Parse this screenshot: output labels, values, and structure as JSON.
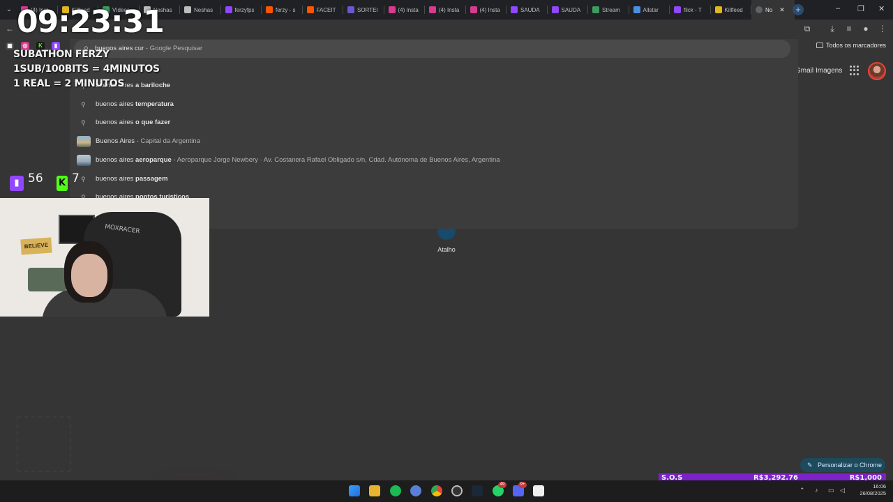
{
  "tabs": [
    {
      "label": "(4) Inst",
      "icon": "instagram-icon",
      "color": "#d63b8f"
    },
    {
      "label": "Killfeed",
      "icon": "killfeed-icon",
      "color": "#e1b521"
    },
    {
      "label": "Vídeos",
      "icon": "drive-icon",
      "color": "#3c9b5e"
    },
    {
      "label": "Neshas",
      "icon": "neshas-icon",
      "color": "#bdbdbd"
    },
    {
      "label": "Neshas",
      "icon": "neshas-icon",
      "color": "#bdbdbd"
    },
    {
      "label": "ferzyfps",
      "icon": "twitch-icon",
      "color": "#9146ff"
    },
    {
      "label": "ferzy - s",
      "icon": "faceit-icon",
      "color": "#ff5500"
    },
    {
      "label": "FACEIT",
      "icon": "faceit-icon",
      "color": "#ff5500"
    },
    {
      "label": "SORTEI",
      "icon": "sorteio-icon",
      "color": "#6e56cf"
    },
    {
      "label": "(4) Insta",
      "icon": "instagram-icon",
      "color": "#d63b8f"
    },
    {
      "label": "(4) Insta",
      "icon": "instagram-icon",
      "color": "#d63b8f"
    },
    {
      "label": "(4) Insta",
      "icon": "instagram-icon",
      "color": "#d63b8f"
    },
    {
      "label": "SAUDA",
      "icon": "twitch-icon",
      "color": "#9146ff"
    },
    {
      "label": "SAUDA",
      "icon": "twitch-icon",
      "color": "#9146ff"
    },
    {
      "label": "Stream",
      "icon": "streamelements-icon",
      "color": "#3c9b5e"
    },
    {
      "label": "Allstar",
      "icon": "allstar-icon",
      "color": "#4a90e2"
    },
    {
      "label": "flick - T",
      "icon": "twitch-icon",
      "color": "#9146ff"
    },
    {
      "label": "Killfeed",
      "icon": "killfeed-icon",
      "color": "#e1b521"
    }
  ],
  "active_tab": {
    "label": "No",
    "close": "✕"
  },
  "new_tab": "+",
  "window_controls": {
    "minimize": "–",
    "restore": "❐",
    "close": "✕"
  },
  "bookmarks": {
    "all": "Todos os marcadores"
  },
  "omnibox": {
    "typed": "buenos aires cur",
    "suffix": " - Google Pesquisar",
    "suggestions": [
      {
        "prefix": "buenos aires ",
        "bold": "a bariloche",
        "detail": "",
        "kind": "search"
      },
      {
        "prefix": "buenos aires ",
        "bold": "temperatura",
        "detail": "",
        "kind": "search"
      },
      {
        "prefix": "buenos aires ",
        "bold": "o que fazer",
        "detail": "",
        "kind": "search"
      },
      {
        "prefix": "Buenos Aires",
        "bold": "",
        "detail": " - Capital da Argentina",
        "kind": "entity"
      },
      {
        "prefix": "buenos aires ",
        "bold": "aeroparque",
        "detail": " - Aeroparque Jorge Newbery · Av. Costanera Rafael Obligado s/n, Cdad. Autónoma de Buenos Aires, Argentina",
        "kind": "place"
      },
      {
        "prefix": "buenos aires ",
        "bold": "passagem",
        "detail": "",
        "kind": "search"
      },
      {
        "prefix": "buenos aires ",
        "bold": "pontos turisticos",
        "detail": "",
        "kind": "search"
      }
    ]
  },
  "ntp": {
    "gmail": "Gmail",
    "images": "Imagens",
    "shortcut_label": "Atalho",
    "customize": "Personalizar o Chrome"
  },
  "overlay": {
    "timer": "09:23:31",
    "line1": "SUBATHON FERZY",
    "line2": "1SUB/100BITS = 4MINUTOS",
    "line3": "1 REAL = 2 MINUTOS",
    "twitch_count": "56",
    "kick_count": "7"
  },
  "webcam": {
    "chair_brand": "MOXRACER",
    "sign": "BELIEVE"
  },
  "goal": {
    "name": "S.O.S",
    "current": "R$3,292.76",
    "target": "R$1,000"
  },
  "taskbar": {
    "items": [
      "windows-start-icon",
      "file-explorer-icon",
      "spotify-icon",
      "app-icon",
      "chrome-icon",
      "obs-icon",
      "steam-icon",
      "whatsapp-icon",
      "discord-icon",
      "capcut-icon"
    ],
    "whatsapp_badge": "49",
    "discord_badge": "9+",
    "time": "16:06",
    "date": "26/08/2025"
  }
}
